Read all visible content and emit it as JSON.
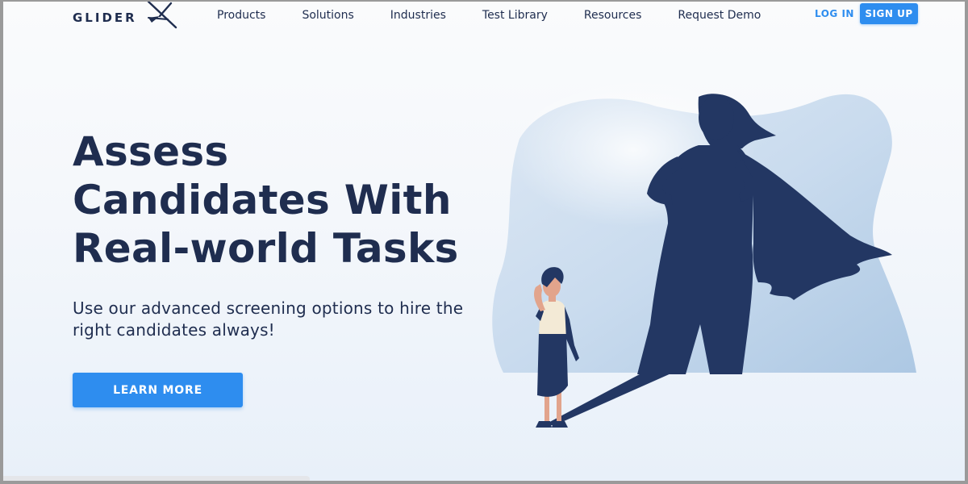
{
  "brand": {
    "name": "GLIDER",
    "icon": "plane-icon"
  },
  "nav": {
    "items": [
      {
        "label": "Products"
      },
      {
        "label": "Solutions"
      },
      {
        "label": "Industries"
      },
      {
        "label": "Test Library"
      },
      {
        "label": "Resources"
      },
      {
        "label": "Request Demo"
      }
    ],
    "login_label": "LOG IN",
    "signup_label": "SIGN UP"
  },
  "hero": {
    "headline": "Assess\nCandidates With\nReal-world Tasks",
    "subtext": "Use our advanced screening options to hire the right candidates always!",
    "cta_label": "LEARN MORE",
    "illustration": "woman-superhero-shadow-illustration"
  },
  "colors": {
    "accent": "#2e8def",
    "navy": "#1f2d4f",
    "background": "#f4f7fb",
    "blob": "#c5d8ec"
  }
}
